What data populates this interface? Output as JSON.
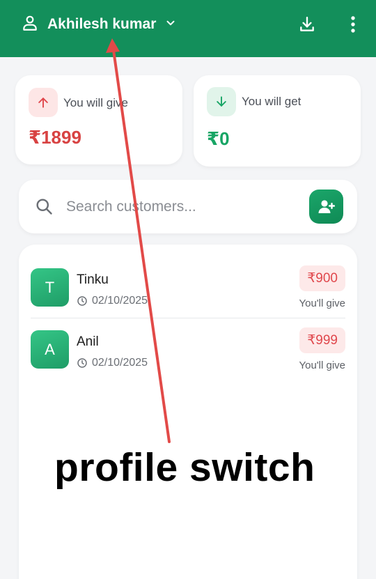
{
  "header": {
    "profile_name": "Akhilesh kumar",
    "icons": [
      "user-icon",
      "chevron-down-icon",
      "download-icon",
      "more-vertical-icon"
    ],
    "background_color": "#138f5b"
  },
  "summary": {
    "give": {
      "label": "You will give",
      "amount": "₹1899",
      "color": "#d84343",
      "icon": "arrow-up-icon"
    },
    "get": {
      "label": "You will get",
      "amount": "₹0",
      "color": "#18a565",
      "icon": "arrow-down-icon"
    }
  },
  "search": {
    "placeholder": "Search customers...",
    "value": ""
  },
  "customers": [
    {
      "initial": "T",
      "name": "Tinku",
      "date": "02/10/2025",
      "amount": "₹900",
      "status": "You'll give"
    },
    {
      "initial": "A",
      "name": "Anil",
      "date": "02/10/2025",
      "amount": "₹999",
      "status": "You'll give"
    }
  ],
  "annotation": {
    "text": "profile switch",
    "arrow_color": "#e24a48"
  }
}
